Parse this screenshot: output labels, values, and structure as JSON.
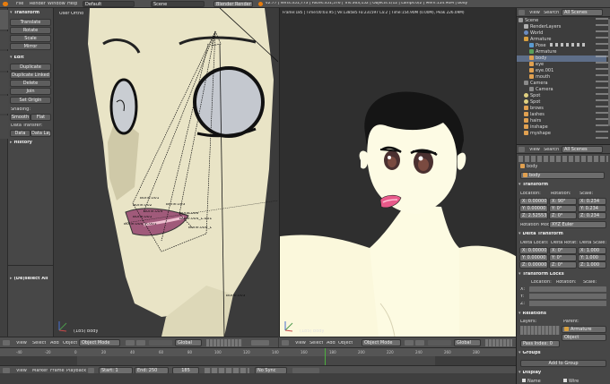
{
  "topbar": {
    "menus": [
      "File",
      "Render",
      "Window",
      "Help"
    ],
    "layout": "Default",
    "scene": "Scene",
    "engine": "Blender Render",
    "stats": "v2.77 | Verts:351,773 | Faces:351,576 | Tris:363,152 | Objects:1/12 | Lamps:0/2 | Mem:154.90M | body"
  },
  "toolshelf": {
    "tabs": [
      "Tools",
      "Create",
      "Relations",
      "Animation",
      "Physics",
      "Grease Pencil"
    ],
    "transform_header": "Transform",
    "transform_buttons": [
      "Translate",
      "Rotate",
      "Scale",
      "Mirror"
    ],
    "edit_header": "Edit",
    "edit_buttons": [
      "Duplicate",
      "Duplicate Linked",
      "Delete",
      "Join"
    ],
    "set_origin": "Set Origin",
    "shading_label": "Shading:",
    "smooth": "Smooth",
    "flat": "Flat",
    "data_transfer_label": "Data Transfer:",
    "data": "Data",
    "data_layout": "Data Layo",
    "history_header": "History",
    "operator_panel": "(De)select All"
  },
  "viewport_left": {
    "label": "User Ortho",
    "status": "(185) body",
    "bone_labels": [
      "Bone.001",
      "Bone.002",
      "Bone.003",
      "Bone.004",
      "Bone.005",
      "Bone.006",
      "Bone.004_L.001",
      "Bone.004_R.001",
      "Bone.006_L",
      "Bone.003"
    ],
    "header": {
      "menus": [
        "View",
        "Select",
        "Add",
        "Object"
      ],
      "mode": "Object Mode",
      "orientation": "Global"
    }
  },
  "viewport_right": {
    "info": "Frame:185 | Time:00:03.95 | Ve:138585 Fa:231597 La:2 | Time:154.90M (0.00M), Peak 226.09M)",
    "status": "(185) body",
    "header": {
      "menus": [
        "View",
        "Select",
        "Add",
        "Object"
      ],
      "mode": "Object Mode",
      "orientation": "Global"
    }
  },
  "timeline": {
    "ticks": [
      "-40",
      "-20",
      "0",
      "20",
      "40",
      "60",
      "80",
      "100",
      "120",
      "140",
      "160",
      "180",
      "200",
      "220",
      "240",
      "260",
      "280"
    ],
    "menus": [
      "View",
      "Marker",
      "Frame",
      "Playback"
    ],
    "start_label": "Start:",
    "start": "1",
    "end_label": "End:",
    "end": "250",
    "current": "185",
    "sync": "No Sync"
  },
  "outliner": {
    "header": {
      "view": "View",
      "search": "Search",
      "filter": "All Scenes"
    },
    "items": [
      {
        "name": "Scene",
        "depth": 0,
        "color": "#9a9a9a"
      },
      {
        "name": "RenderLayers",
        "depth": 1,
        "color": "#b0b0b0"
      },
      {
        "name": "World",
        "depth": 1,
        "color": "#6a8bc0"
      },
      {
        "name": "Armature",
        "depth": 1,
        "color": "#d8a040"
      },
      {
        "name": "Pose",
        "depth": 2,
        "color": "#5a9ad0"
      },
      {
        "name": "Armature",
        "depth": 2,
        "color": "#5aa05a"
      },
      {
        "name": "body",
        "depth": 2,
        "color": "#e0a050",
        "selected": true
      },
      {
        "name": "eye",
        "depth": 2,
        "color": "#e0a050"
      },
      {
        "name": "eye.001",
        "depth": 2,
        "color": "#e0a050"
      },
      {
        "name": "mouth",
        "depth": 2,
        "color": "#e0a050"
      },
      {
        "name": "Camera",
        "depth": 1,
        "color": "#8a8a8a"
      },
      {
        "name": "Camera",
        "depth": 2,
        "color": "#8a8a8a"
      },
      {
        "name": "Spot",
        "depth": 1,
        "color": "#e0d080"
      },
      {
        "name": "Spot",
        "depth": 1,
        "color": "#e0d080"
      },
      {
        "name": "brows",
        "depth": 1,
        "color": "#e0a050"
      },
      {
        "name": "lashes",
        "depth": 1,
        "color": "#e0a050"
      },
      {
        "name": "hairs",
        "depth": 1,
        "color": "#e0a050"
      },
      {
        "name": "inshape",
        "depth": 1,
        "color": "#e0a050"
      },
      {
        "name": "myshape",
        "depth": 1,
        "color": "#e0a050"
      }
    ]
  },
  "properties": {
    "header": {
      "view": "View",
      "search": "Search",
      "filter": "All Scenes"
    },
    "breadcrumb": "body",
    "object_name": "body",
    "transform_header": "Transform",
    "col_location": "Location:",
    "col_rotation": "Rotation:",
    "col_scale": "Scale:",
    "location": [
      "X: 0.00000",
      "Y: 0.00000",
      "Z: 2.52553"
    ],
    "rotation": [
      "X: 90°",
      "Y: 0°",
      "Z: 0°"
    ],
    "scale": [
      "X: 0.234",
      "Y: 0.234",
      "Z: 0.234"
    ],
    "rotation_mode_label": "Rotation Mode:",
    "rotation_mode": "XYZ Euler",
    "delta_header": "Delta Transform",
    "delta_col_location": "Delta Locati:",
    "delta_col_rotation": "Delta Rotat:",
    "delta_col_scale": "Delta Scale:",
    "delta_location": [
      "X: 0.00000",
      "Y: 0.00000",
      "Z: 0.00000"
    ],
    "delta_rotation": [
      "X: 0°",
      "Y: 0°",
      "Z: 0°"
    ],
    "delta_scale": [
      "X: 1.000",
      "Y: 1.000",
      "Z: 1.000"
    ],
    "locks_header": "Transform Locks",
    "locks_cols": [
      "Location:",
      "Rotation:",
      "Scale:"
    ],
    "locks_axes": [
      "X:",
      "Y:",
      "Z:"
    ],
    "relations_header": "Relations",
    "layers_label": "Layers:",
    "parent_label": "Parent:",
    "parent": "Armature",
    "parent_type": "Object",
    "pass_index": "Pass Index: 0",
    "groups_header": "Groups",
    "add_to_group": "Add to Group",
    "display_header": "Display",
    "display_name": "Name",
    "display_wire": "Wire"
  }
}
